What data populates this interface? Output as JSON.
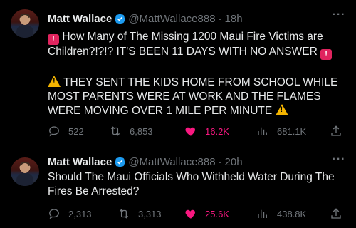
{
  "tweets": [
    {
      "name": "Matt Wallace",
      "handle": "@MattWallace888",
      "dot": "·",
      "time": "18h",
      "paragraphs": [
        "How Many of The Missing 1200 Maui Fire Victims are Children?!?!? IT'S BEEN 11 DAYS WITH NO ANSWER",
        "THEY SENT THE KIDS HOME FROM SCHOOL WHILE MOST PARENTS WERE AT WORK AND THE FLAMES WERE MOVING OVER 1 MILE PER MINUTE"
      ],
      "replies": "522",
      "retweets": "6,853",
      "likes": "16.2K",
      "views": "681.1K",
      "liked": true
    },
    {
      "name": "Matt Wallace",
      "handle": "@MattWallace888",
      "dot": "·",
      "time": "20h",
      "paragraphs": [
        "Should The Maui Officials Who Withheld Water During The Fires Be Arrested?"
      ],
      "replies": "2,313",
      "retweets": "3,313",
      "likes": "25.6K",
      "views": "438.8K",
      "liked": true
    }
  ],
  "more_label": "···",
  "icons": [
    "avatar",
    "verified-badge-icon",
    "more-icon",
    "siren-emoji",
    "warning-emoji",
    "reply-icon",
    "retweet-icon",
    "heart-icon",
    "views-icon",
    "share-icon"
  ],
  "colors": {
    "background": "#000000",
    "text": "#e7e9ea",
    "muted": "#71767b",
    "verified": "#1d9bf0",
    "like": "#f91880",
    "divider": "#2f3336"
  }
}
